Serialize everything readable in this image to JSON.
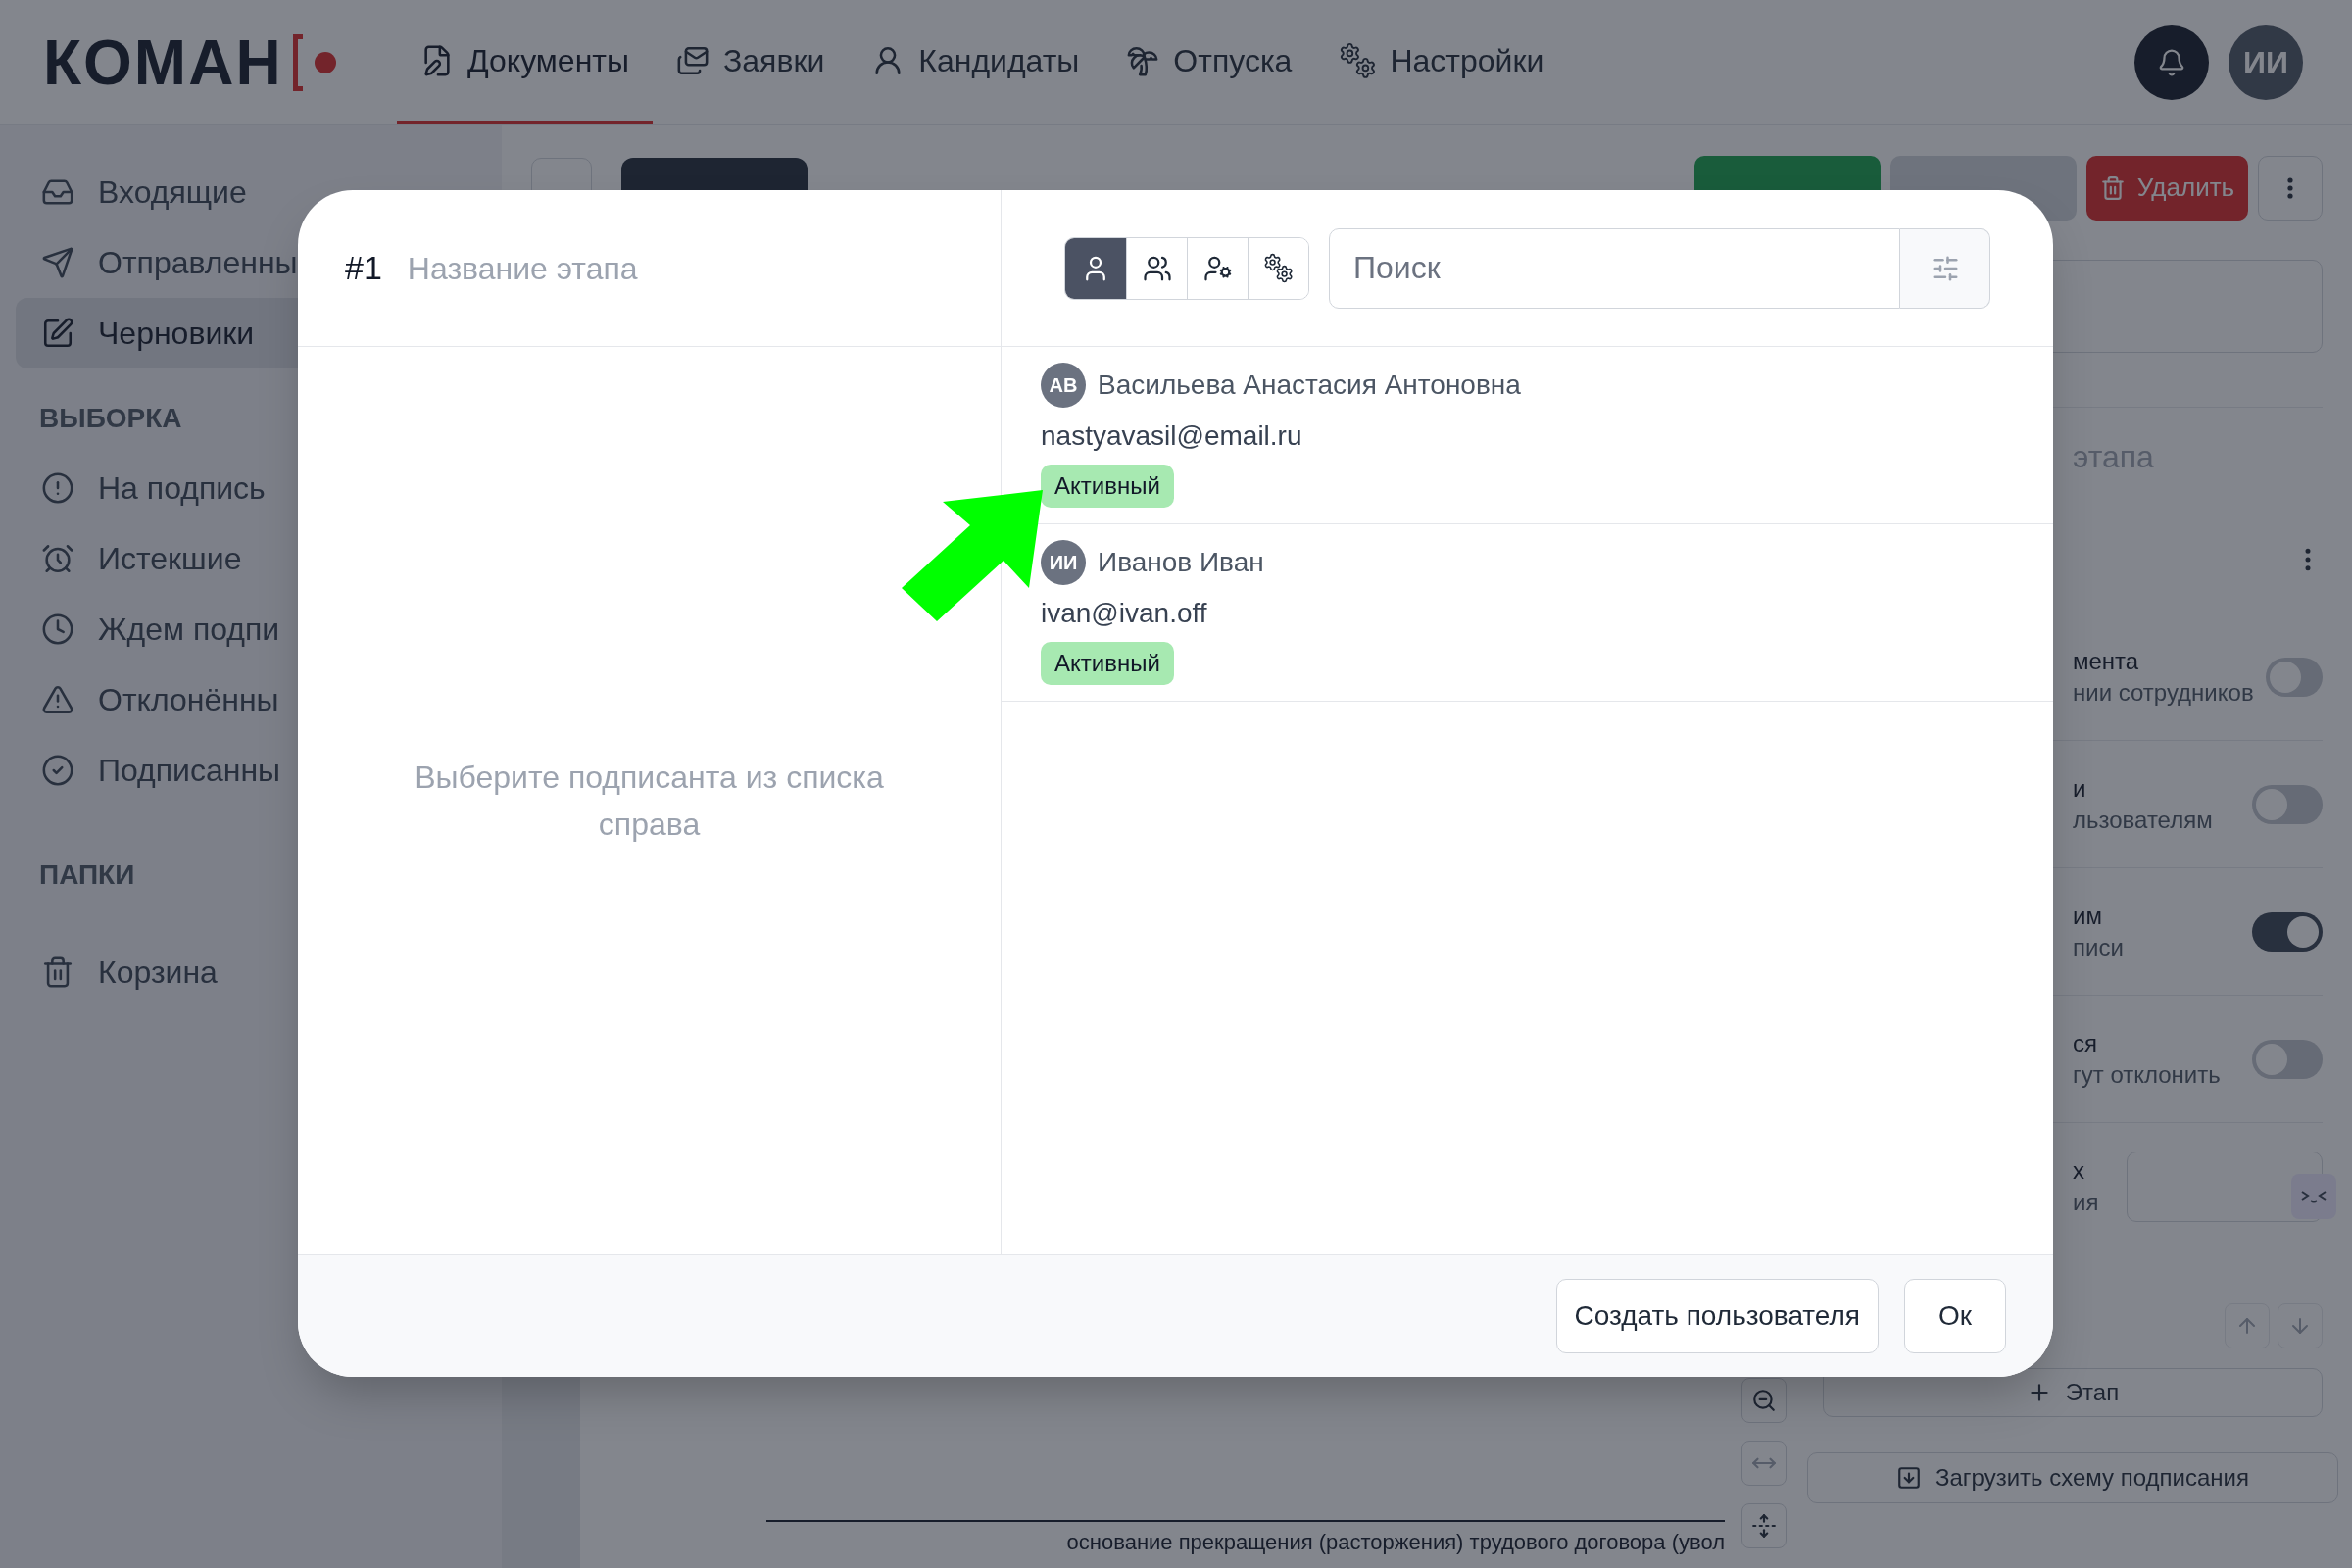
{
  "header": {
    "logo": "КОМАН",
    "nav": [
      {
        "label": "Документы",
        "selected": true
      },
      {
        "label": "Заявки",
        "selected": false
      },
      {
        "label": "Кандидаты",
        "selected": false
      },
      {
        "label": "Отпуска",
        "selected": false
      },
      {
        "label": "Настройки",
        "selected": false
      }
    ],
    "user_initials": "ИИ"
  },
  "sidebar": {
    "sections": [
      {
        "items": [
          {
            "label": "Входящие",
            "selected": false
          },
          {
            "label": "Отправленны",
            "selected": false
          },
          {
            "label": "Черновики",
            "selected": true
          }
        ]
      },
      {
        "title": "ВЫБОРКА",
        "items": [
          {
            "label": "На подпись",
            "selected": false
          },
          {
            "label": "Истекшие",
            "selected": false
          },
          {
            "label": "Ждем подпи",
            "selected": false
          },
          {
            "label": "Отклонённы",
            "selected": false
          },
          {
            "label": "Подписанны",
            "selected": false
          }
        ]
      },
      {
        "title": "ПАПКИ",
        "items": [
          {
            "label": "Корзина",
            "selected": false
          }
        ]
      }
    ]
  },
  "toolbar": {
    "buttons": [
      {
        "kind": "save"
      },
      {
        "kind": "send"
      },
      {
        "kind": "delete",
        "label": "Удалить"
      },
      {
        "kind": "more"
      }
    ]
  },
  "document": {
    "text": "основание прекращения (расторжения) трудового договора (увол"
  },
  "settings_panel": {
    "stage_name_fragment": "этапа",
    "rows": [
      {
        "kind": "toggle",
        "title": "мента",
        "subtitle": "нии сотрудников",
        "on": false
      },
      {
        "kind": "toggle",
        "title": "и",
        "subtitle": "льзователям",
        "on": false
      },
      {
        "kind": "toggle",
        "title": "им",
        "subtitle": "писи",
        "on": true
      },
      {
        "kind": "toggle",
        "title": "ся",
        "subtitle": "гут отклонить",
        "on": false
      },
      {
        "kind": "input",
        "title": "х",
        "subtitle": "ия"
      }
    ],
    "add_stage": "Этап",
    "load_scheme": "Загрузить схему подписания"
  },
  "modal": {
    "stage_number": "#1",
    "stage_name_placeholder": "Название этапа",
    "empty_hint": "Выберите подписанта из списка справа",
    "filter_tabs": [
      {
        "selected": true
      },
      {
        "selected": false
      },
      {
        "selected": false
      },
      {
        "selected": false
      }
    ],
    "search_placeholder": "Поиск",
    "users": [
      {
        "initials": "АВ",
        "name": "Васильева Анастасия Антоновна",
        "email": "nastyavasil@email.ru",
        "status": "Активный"
      },
      {
        "initials": "ИИ",
        "name": "Иванов Иван",
        "email": "ivan@ivan.off",
        "status": "Активный"
      }
    ],
    "create_user": "Создать пользователя",
    "ok": "Ок"
  }
}
